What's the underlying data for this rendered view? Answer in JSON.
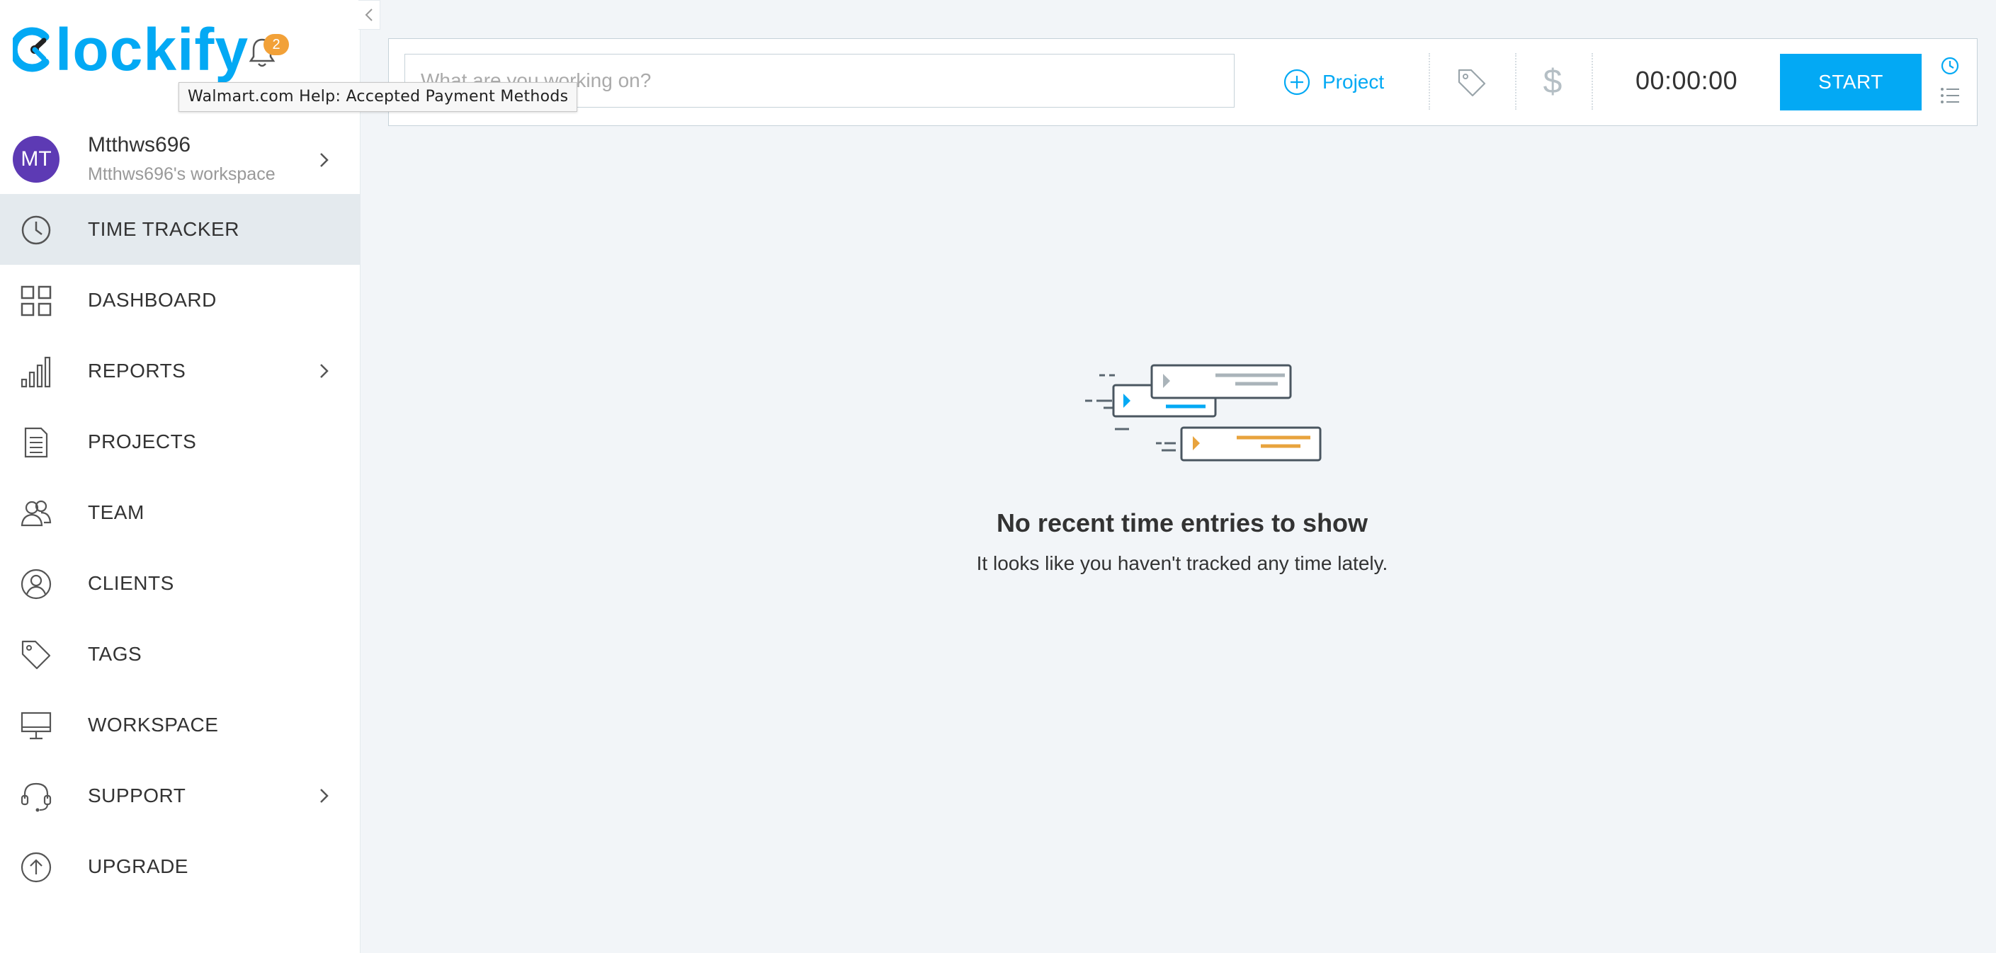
{
  "app": {
    "logo_text": "lockify",
    "notification_count": "2"
  },
  "tooltip": {
    "text": "Walmart.com Help: Accepted Payment Methods"
  },
  "user": {
    "initials": "MT",
    "name": "Mtthws696",
    "workspace": "Mtthws696's workspace"
  },
  "sidebar": {
    "items": [
      {
        "label": "TIME TRACKER",
        "icon": "clock-icon",
        "active": true
      },
      {
        "label": "DASHBOARD",
        "icon": "dashboard-grid-icon"
      },
      {
        "label": "REPORTS",
        "icon": "bar-chart-icon",
        "has_submenu": true
      },
      {
        "label": "PROJECTS",
        "icon": "document-icon"
      },
      {
        "label": "TEAM",
        "icon": "team-icon"
      },
      {
        "label": "CLIENTS",
        "icon": "client-icon"
      },
      {
        "label": "TAGS",
        "icon": "tag-icon"
      },
      {
        "label": "WORKSPACE",
        "icon": "monitor-icon"
      },
      {
        "label": "SUPPORT",
        "icon": "headset-icon",
        "has_submenu": true
      },
      {
        "label": "UPGRADE",
        "icon": "upgrade-arrow-icon"
      }
    ]
  },
  "tracker": {
    "description_placeholder": "What are you working on?",
    "description_value": "",
    "project_label": "Project",
    "billable_symbol": "$",
    "timer": "00:00:00",
    "start_label": "START"
  },
  "empty_state": {
    "title": "No recent time entries to show",
    "subtitle": "It looks like you haven't tracked any time lately."
  },
  "colors": {
    "accent": "#03a9f4",
    "badge": "#f2a138",
    "avatar": "#5d3ab4",
    "illus_orange": "#e8a33d"
  }
}
